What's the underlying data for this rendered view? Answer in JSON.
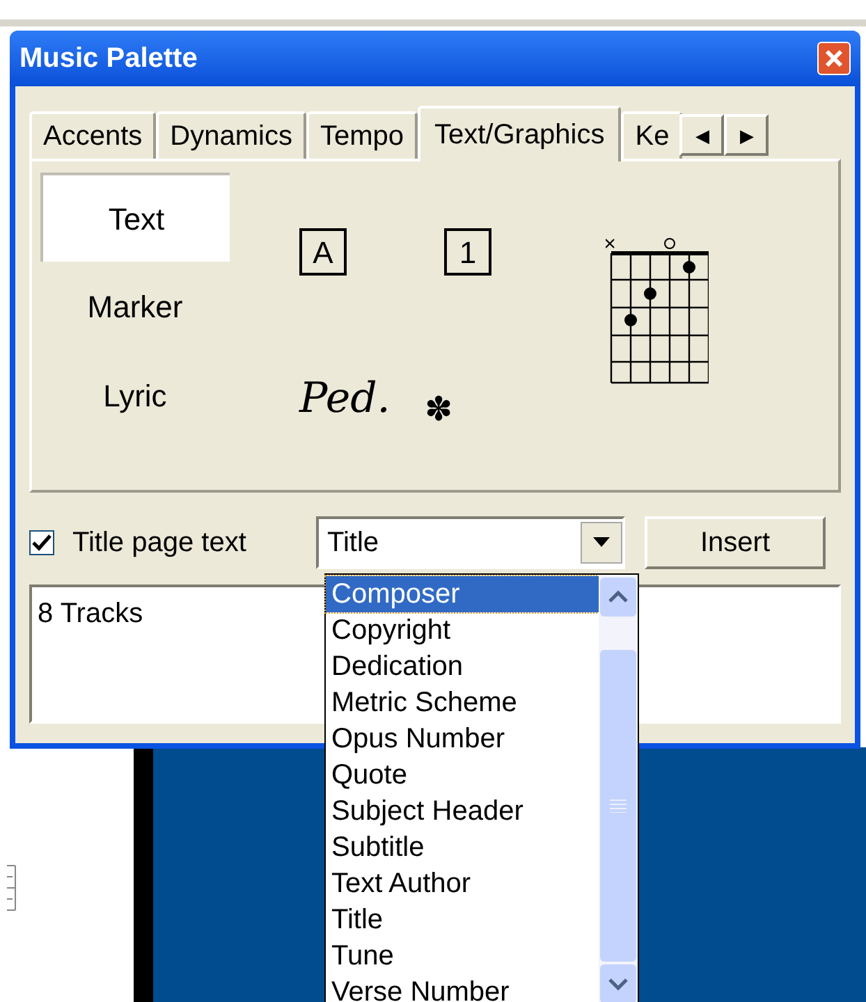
{
  "window": {
    "title": "Music Palette"
  },
  "tabs": [
    {
      "label": "Accents",
      "selected": false
    },
    {
      "label": "Dynamics",
      "selected": false
    },
    {
      "label": "Tempo",
      "selected": false
    },
    {
      "label": "Text/Graphics",
      "selected": true
    },
    {
      "label": "Ke",
      "selected": false
    }
  ],
  "tab_scroll": [
    "◀",
    "▶"
  ],
  "text_items": [
    {
      "label": "Text",
      "selected": true
    },
    {
      "label": "Marker",
      "selected": false
    },
    {
      "label": "Lyric",
      "selected": false
    }
  ],
  "symbols": [
    {
      "kind": "boxed",
      "label": "A"
    },
    {
      "kind": "boxed",
      "label": "1"
    },
    {
      "kind": "pedal",
      "label": "Ped."
    },
    {
      "kind": "release",
      "label": "✽"
    }
  ],
  "title_page_text": {
    "label": "Title page text",
    "checked": true
  },
  "combo": {
    "value": "Title",
    "expanded": true
  },
  "insert_button": "Insert",
  "text_area": {
    "value": "8 Tracks"
  },
  "dropdown": [
    {
      "label": "Composer",
      "selected": true
    },
    {
      "label": "Copyright",
      "selected": false
    },
    {
      "label": "Dedication",
      "selected": false
    },
    {
      "label": "Metric Scheme",
      "selected": false
    },
    {
      "label": "Opus Number",
      "selected": false
    },
    {
      "label": "Quote",
      "selected": false
    },
    {
      "label": "Subject Header",
      "selected": false
    },
    {
      "label": "Subtitle",
      "selected": false
    },
    {
      "label": "Text Author",
      "selected": false
    },
    {
      "label": "Title",
      "selected": false
    },
    {
      "label": "Tune",
      "selected": false
    },
    {
      "label": "Verse Number",
      "selected": false
    }
  ]
}
